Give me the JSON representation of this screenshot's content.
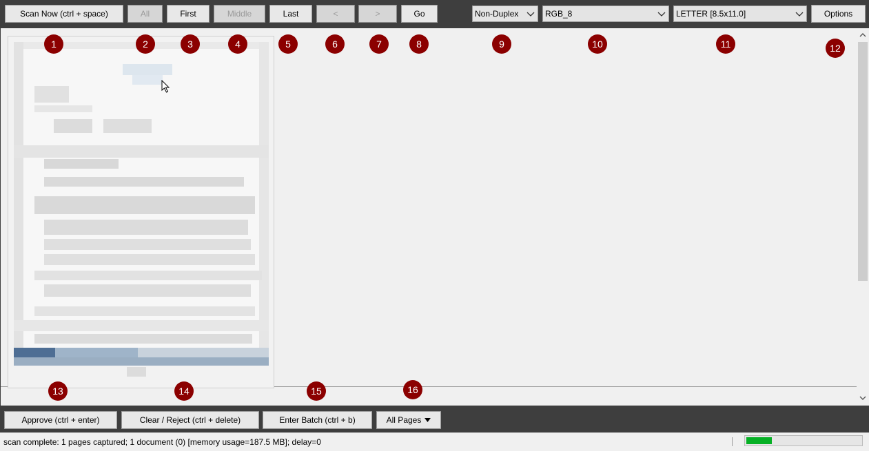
{
  "toolbar": {
    "scan_now": "Scan Now (ctrl + space)",
    "all": "All",
    "first": "First",
    "middle": "Middle",
    "last": "Last",
    "prev": "<",
    "next": ">",
    "go": "Go",
    "duplex": "Non-Duplex",
    "color_mode": "RGB_8",
    "paper_size": "LETTER [8.5x11.0]",
    "options": "Options"
  },
  "badges": [
    "1",
    "2",
    "3",
    "4",
    "5",
    "6",
    "7",
    "8",
    "9",
    "10",
    "11",
    "12",
    "13",
    "14",
    "15",
    "16"
  ],
  "bottom": {
    "approve": "Approve (ctrl + enter)",
    "clear_reject": "Clear / Reject (ctrl + delete)",
    "enter_batch": "Enter Batch (ctrl + b)",
    "all_pages": "All Pages"
  },
  "status": {
    "text": "scan complete: 1 pages captured; 1 document (0) [memory usage=187.5 MB]; delay=0",
    "progress_fraction": 0.22
  },
  "icons": {
    "dropdown": "chevron-down-icon",
    "caret": "caret-down-icon",
    "cursor": "mouse-pointer-icon"
  },
  "colors": {
    "badge": "#8b0000",
    "toolbar": "#3e3e3e",
    "progress": "#06b025"
  }
}
